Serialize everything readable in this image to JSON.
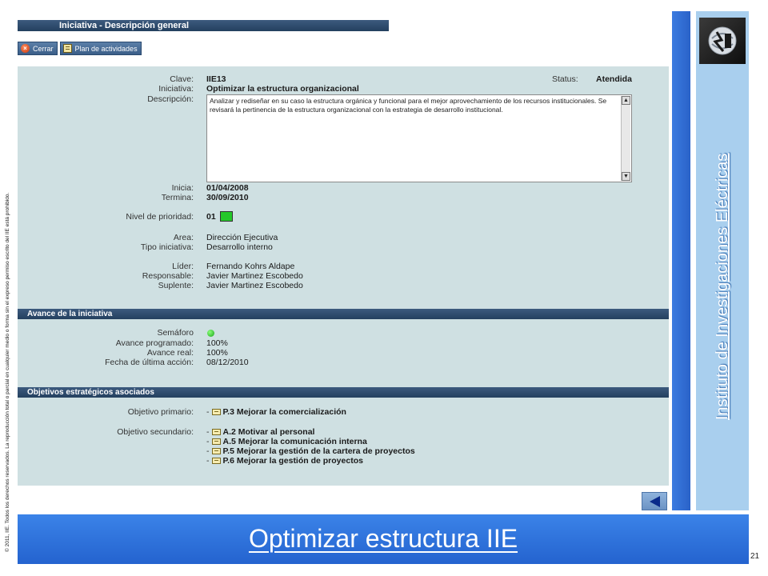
{
  "copyright": "© 2011, IIE. Todos los derechos reservados. La reproducción total o parcial en cualquier medio o forma sin el expreso permiso escrito del IIE está prohibido.",
  "window_title": "Iniciativa - Descripción general",
  "toolbar": {
    "close_label": "Cerrar",
    "plan_label": "Plan de actividades"
  },
  "general": {
    "clave_label": "Clave:",
    "clave_value": "IIE13",
    "status_label": "Status:",
    "status_value": "Atendida",
    "iniciativa_label": "Iniciativa:",
    "iniciativa_value": "Optimizar la estructura organizacional",
    "descripcion_label": "Descripción:",
    "descripcion_value": "Analizar y rediseñar en su caso la estructura orgánica y funcional para el mejor aprovechamiento de los recursos institucionales. Se revisará la pertinencia de la estructura organizacional con la estrategia de desarrollo institucional.",
    "inicia_label": "Inicia:",
    "inicia_value": "01/04/2008",
    "termina_label": "Termina:",
    "termina_value": "30/09/2010",
    "prioridad_label": "Nivel de prioridad:",
    "prioridad_value": "01",
    "prioridad_color": "#25c82a",
    "area_label": "Area:",
    "area_value": "Dirección Ejecutiva",
    "tipo_label": "Tipo iniciativa:",
    "tipo_value": "Desarrollo interno",
    "lider_label": "Líder:",
    "lider_value": "Fernando Kohrs Aldape",
    "responsable_label": "Responsable:",
    "responsable_value": "Javier Martinez Escobedo",
    "suplente_label": "Suplente:",
    "suplente_value": "Javier Martinez Escobedo"
  },
  "avance": {
    "section_title": "Avance de la iniciativa",
    "semaforo_label": "Semáforo",
    "semaforo_color": "#1aa51a",
    "programado_label": "Avance programado:",
    "programado_value": "100%",
    "real_label": "Avance real:",
    "real_value": "100%",
    "fecha_label": "Fecha de última acción:",
    "fecha_value": "08/12/2010"
  },
  "objetivos": {
    "section_title": "Objetivos estratégicos asociados",
    "primario_label": "Objetivo primario:",
    "primario": [
      "P.3 Mejorar la comercialización"
    ],
    "secundario_label": "Objetivo secundario:",
    "secundario": [
      "A.2 Motivar al personal",
      "A.5 Mejorar la comunicación interna",
      "P.5 Mejorar la gestión de la cartera de proyectos",
      "P.6 Mejorar la gestión de proyectos"
    ],
    "dash": "-"
  },
  "sidebar": {
    "institute": "Instituto de Investigaciones Eléctricas"
  },
  "banner": {
    "title": "Optimizar estructura IIE"
  },
  "page_number": "21"
}
